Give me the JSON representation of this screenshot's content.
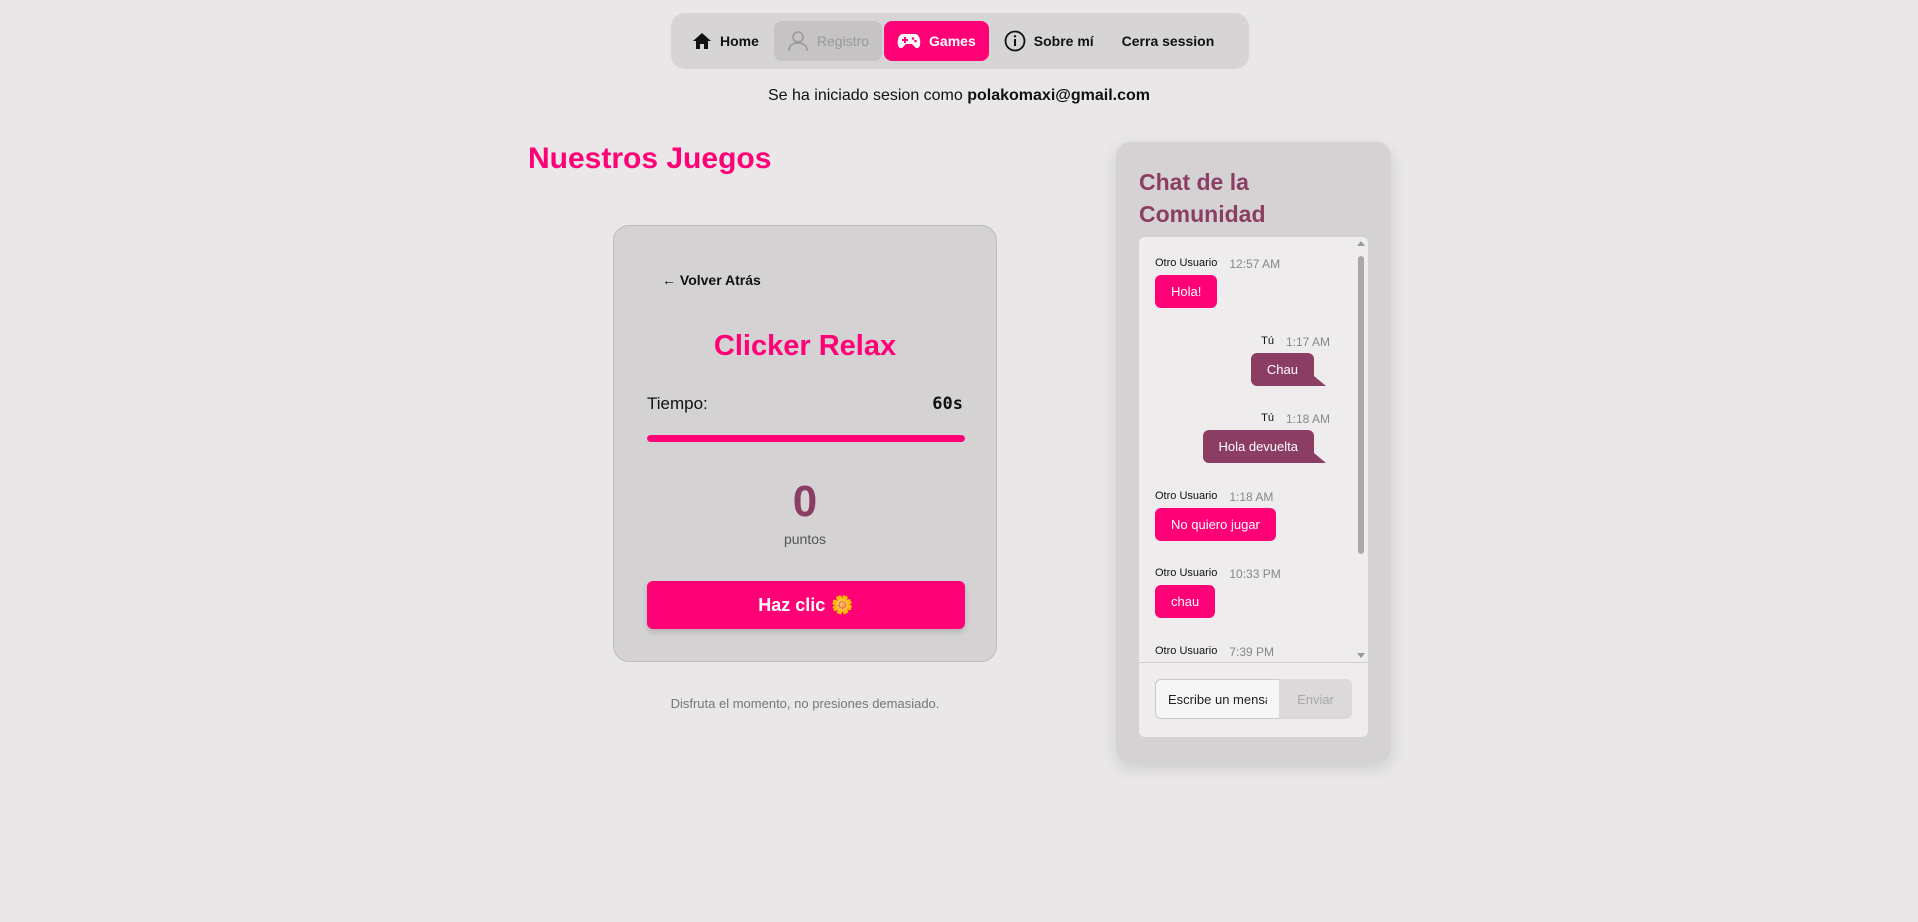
{
  "nav": {
    "items": [
      {
        "label": "Home",
        "icon": "home-icon",
        "state": "normal"
      },
      {
        "label": "Registro",
        "icon": "user-icon",
        "state": "disabled"
      },
      {
        "label": "Games",
        "icon": "gamepad-icon",
        "state": "active"
      },
      {
        "label": "Sobre mí",
        "icon": "info-icon",
        "state": "normal"
      },
      {
        "label": "Cerra session",
        "icon": "",
        "state": "normal"
      }
    ]
  },
  "session": {
    "prefix": "Se ha iniciado sesion como",
    "email": "polakomaxi@gmail.com"
  },
  "games": {
    "heading": "Nuestros Juegos",
    "back_label": "← Volver Atrás",
    "title": "Clicker Relax",
    "time_label": "Tiempo:",
    "time_value": "60s",
    "time_progress": 1.0,
    "score": "0",
    "score_label": "puntos",
    "click_label": "Haz clic",
    "click_emoji": "🌼",
    "tagline": "Disfruta el momento, no presiones demasiado."
  },
  "chat": {
    "title": "Chat de la Comunidad",
    "messages": [
      {
        "author": "Otro Usuario",
        "time": "12:57 AM",
        "text": "Hola!",
        "mine": false
      },
      {
        "author": "Tú",
        "time": "1:17 AM",
        "text": "Chau",
        "mine": true
      },
      {
        "author": "Tú",
        "time": "1:18 AM",
        "text": "Hola devuelta",
        "mine": true
      },
      {
        "author": "Otro Usuario",
        "time": "1:18 AM",
        "text": "No quiero jugar",
        "mine": false
      },
      {
        "author": "Otro Usuario",
        "time": "10:33 PM",
        "text": "chau",
        "mine": false
      },
      {
        "author": "Otro Usuario",
        "time": "7:39 PM",
        "text": "",
        "mine": false
      }
    ],
    "input_placeholder": "Escribe un mensaje",
    "send_label": "Enviar"
  },
  "colors": {
    "accent": "#ff0077",
    "secondary": "#8c3d64",
    "background": "#e9e7e8",
    "panel": "#d4d2d3"
  }
}
